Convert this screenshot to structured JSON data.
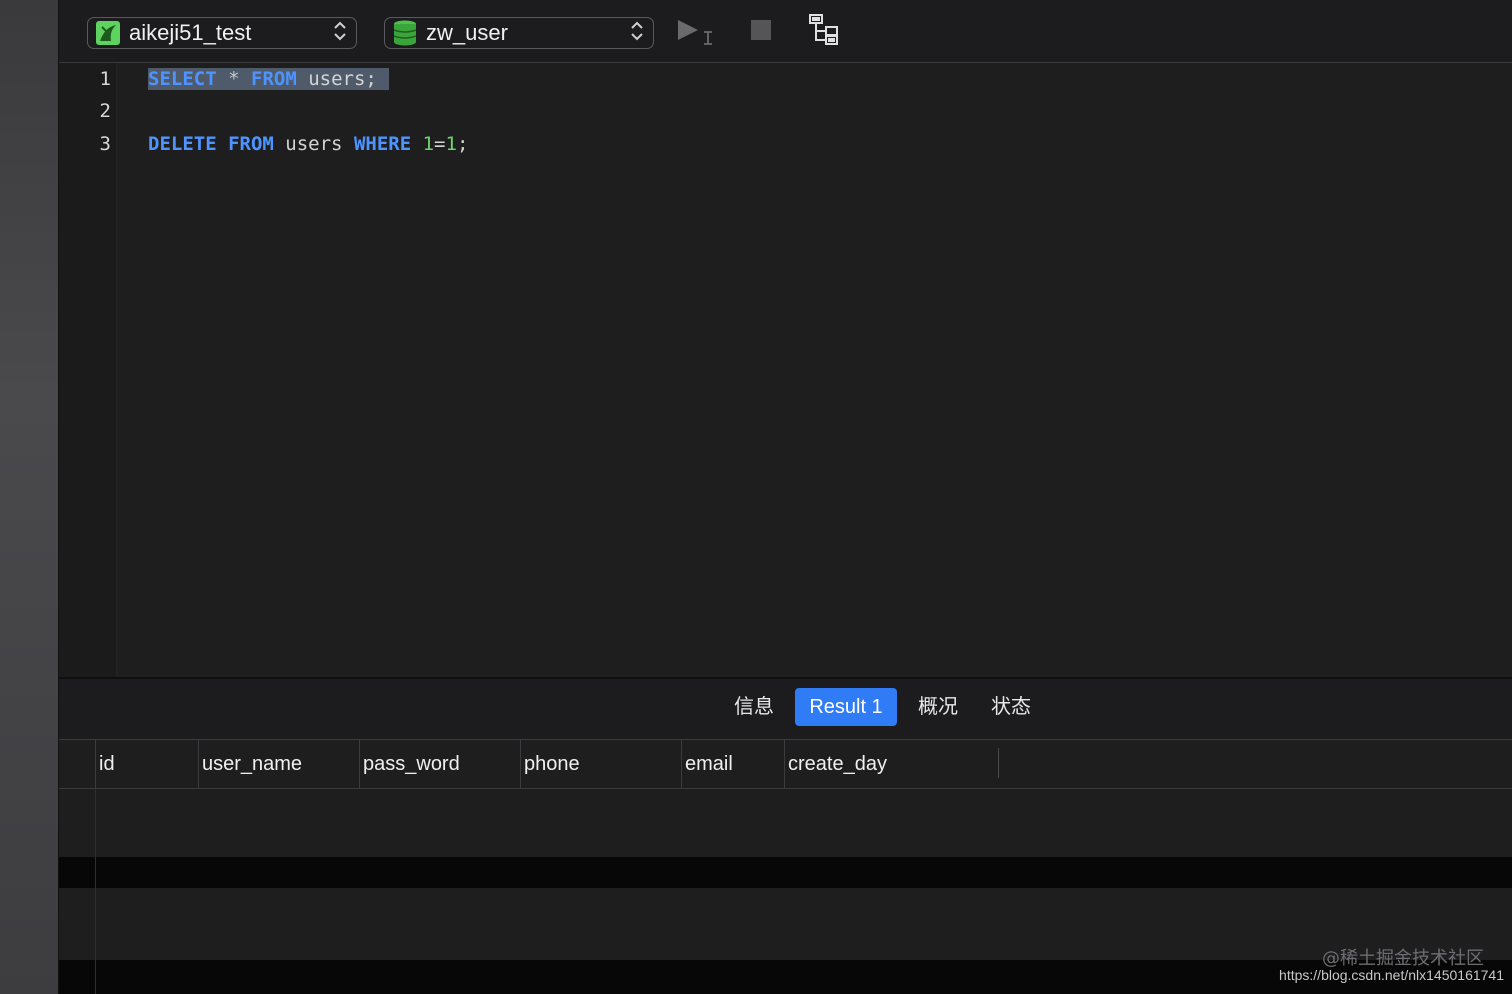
{
  "toolbar": {
    "connection": {
      "label": "aikeji51_test",
      "icon": "mysql-connection-icon"
    },
    "database": {
      "label": "zw_user",
      "icon": "database-icon"
    },
    "run_icon": "run-selected-icon",
    "stop_icon": "stop-icon",
    "explain_icon": "explain-icon"
  },
  "editor": {
    "lines": [
      {
        "no": "1",
        "tokens": [
          {
            "text": "SELECT",
            "type": "kw"
          },
          {
            "text": " ",
            "type": "plain"
          },
          {
            "text": "*",
            "type": "op"
          },
          {
            "text": " ",
            "type": "plain"
          },
          {
            "text": "FROM",
            "type": "kw"
          },
          {
            "text": " users;",
            "type": "plain"
          }
        ],
        "selected": true
      },
      {
        "no": "2",
        "tokens": [],
        "selected": false
      },
      {
        "no": "3",
        "tokens": [
          {
            "text": "DELETE",
            "type": "kw"
          },
          {
            "text": " ",
            "type": "plain"
          },
          {
            "text": "FROM",
            "type": "kw"
          },
          {
            "text": " users ",
            "type": "plain"
          },
          {
            "text": "WHERE",
            "type": "kw"
          },
          {
            "text": " ",
            "type": "plain"
          },
          {
            "text": "1",
            "type": "num"
          },
          {
            "text": "=",
            "type": "plain"
          },
          {
            "text": "1",
            "type": "num"
          },
          {
            "text": ";",
            "type": "plain"
          }
        ],
        "selected": false
      }
    ]
  },
  "result_tabs": {
    "items": [
      {
        "label": "信息",
        "active": false
      },
      {
        "label": "Result 1",
        "active": true
      },
      {
        "label": "概况",
        "active": false
      },
      {
        "label": "状态",
        "active": false
      }
    ]
  },
  "grid": {
    "columns": [
      "id",
      "user_name",
      "pass_word",
      "phone",
      "email",
      "create_day"
    ]
  },
  "watermark": {
    "text": "@稀土掘金技术社区",
    "url": "https://blog.csdn.net/nlx1450161741"
  },
  "colors": {
    "accent": "#2f7cf6",
    "keyword": "#4d94ff",
    "number": "#6fd36f",
    "selection": "#4f5b6b",
    "connection_green": "#5fd35f"
  }
}
